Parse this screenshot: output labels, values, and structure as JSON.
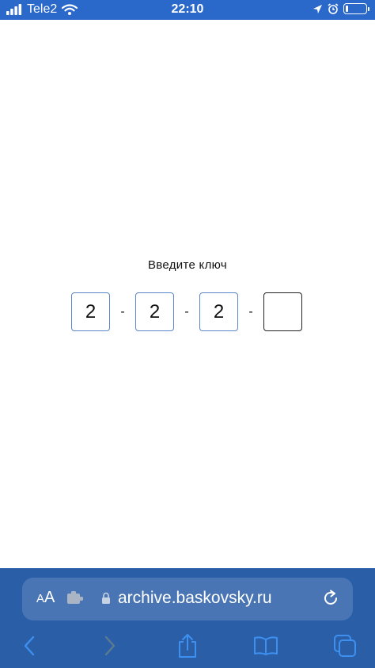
{
  "status_bar": {
    "carrier": "Tele2",
    "time": "22:10",
    "battery_level": 0.15
  },
  "main": {
    "prompt": "Введите ключ",
    "key_fields": [
      {
        "value": "2"
      },
      {
        "value": "2"
      },
      {
        "value": "2"
      },
      {
        "value": ""
      }
    ],
    "separator": "-"
  },
  "browser": {
    "aa_small": "A",
    "aa_large": "A",
    "url": "archive.baskovsky.ru"
  },
  "colors": {
    "status_bar_bg": "#2a68c9",
    "chrome_bg": "#2a5fa8",
    "address_bar_bg": "#4975b5",
    "field_border": "#5b86c9"
  }
}
